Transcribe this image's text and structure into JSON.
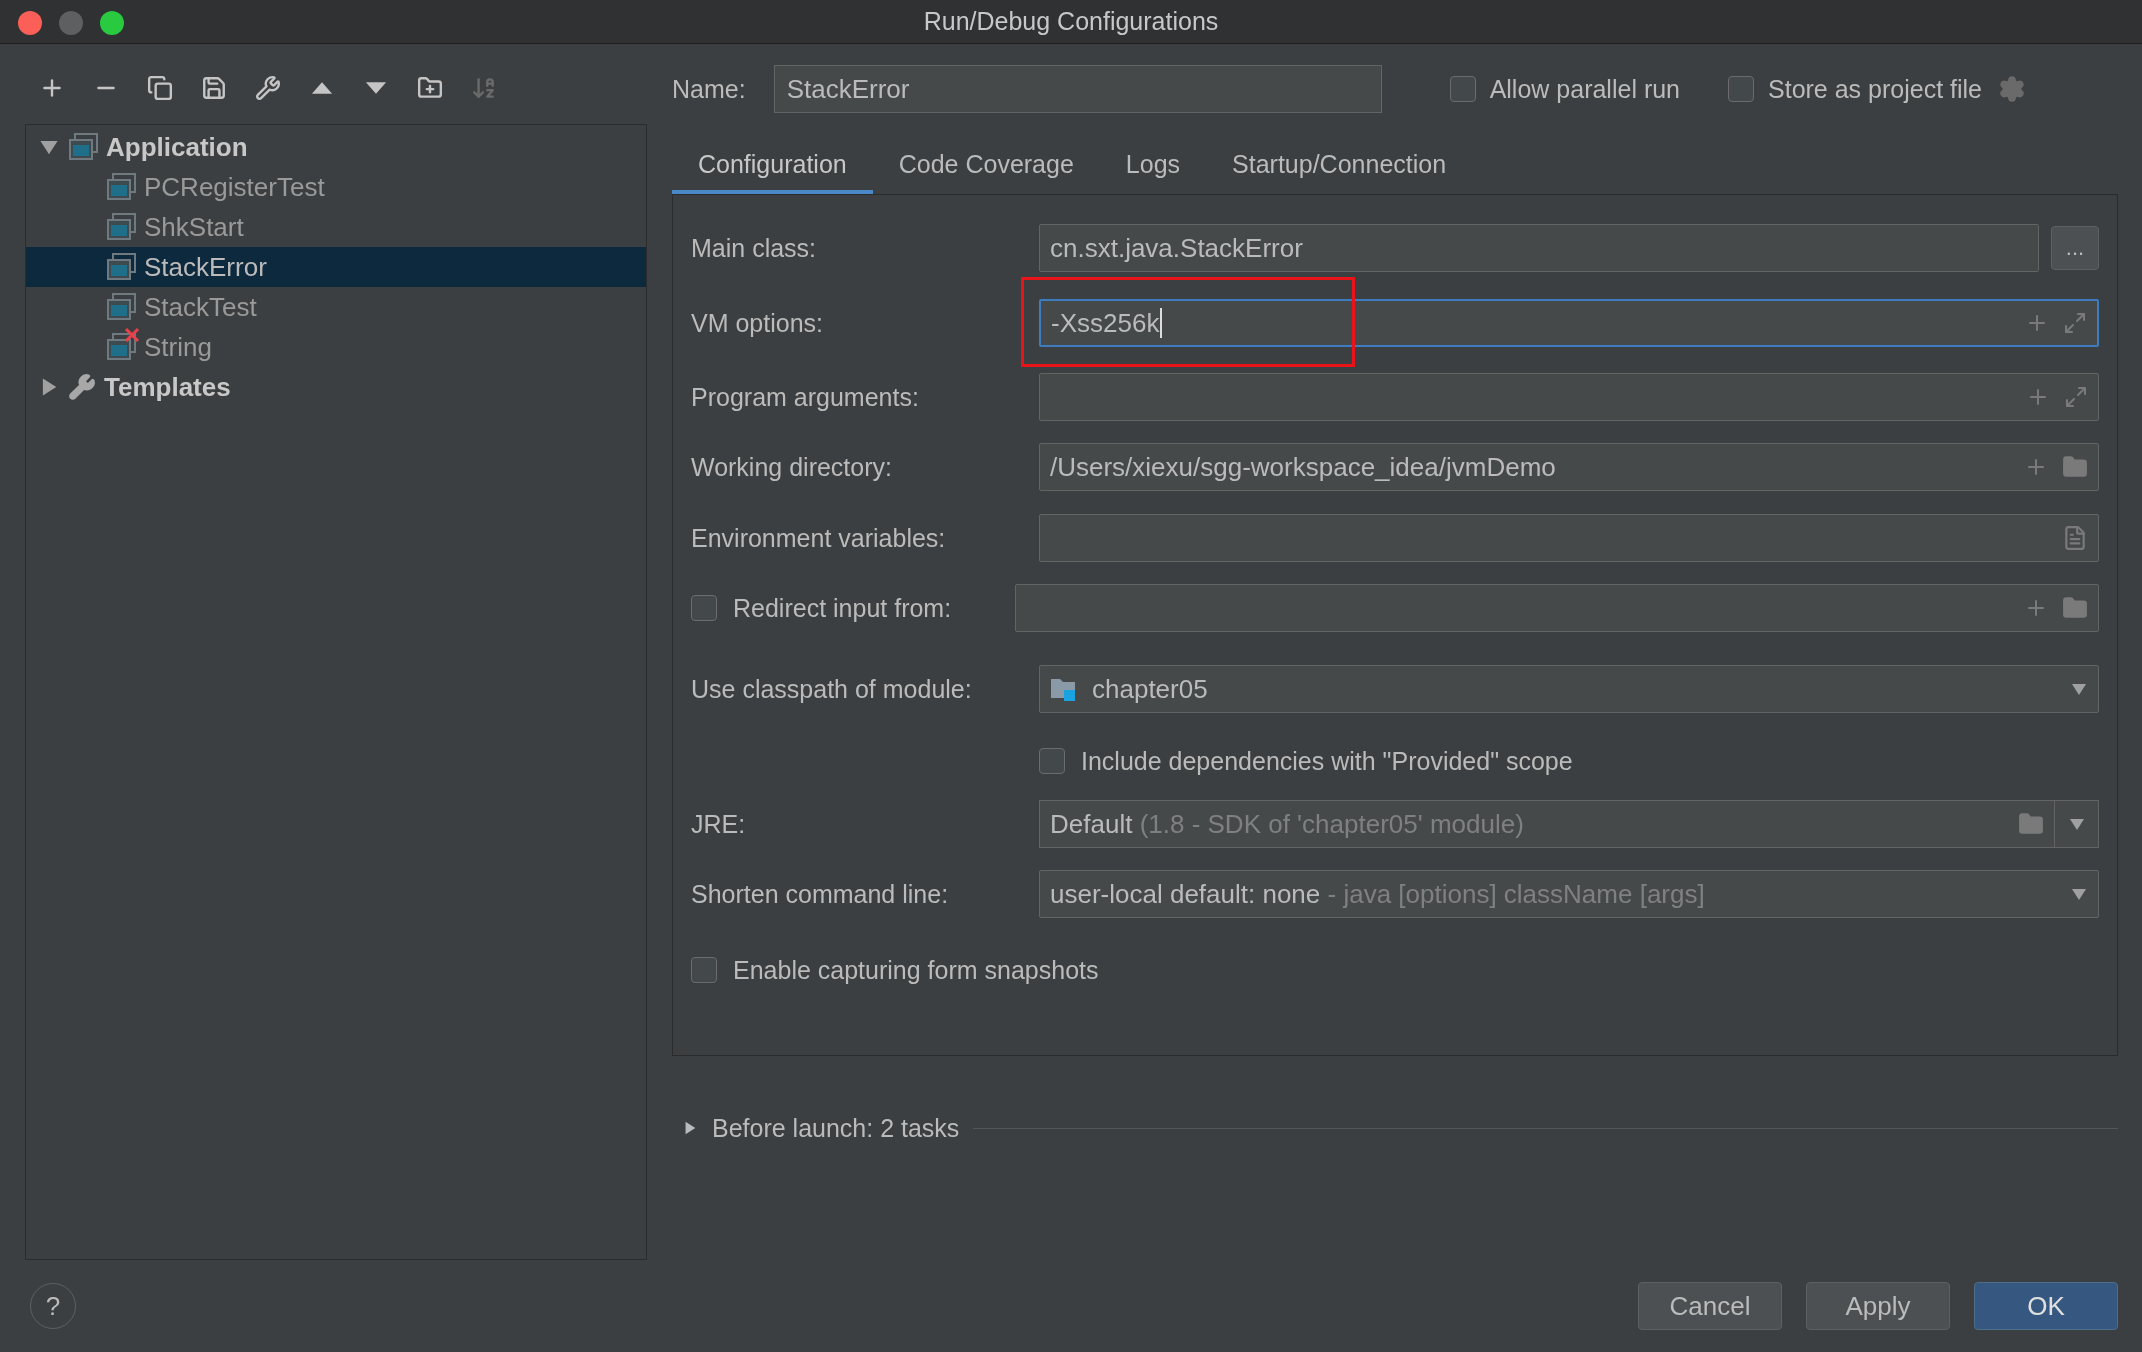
{
  "window": {
    "title": "Run/Debug Configurations"
  },
  "tree": [
    {
      "label": "Application",
      "kind": "application",
      "expanded": true,
      "children": [
        {
          "label": "PCRegisterTest",
          "selected": false,
          "error": false
        },
        {
          "label": "ShkStart",
          "selected": false,
          "error": false
        },
        {
          "label": "StackError",
          "selected": true,
          "error": false
        },
        {
          "label": "StackTest",
          "selected": false,
          "error": false
        },
        {
          "label": "String",
          "selected": false,
          "error": true
        }
      ]
    },
    {
      "label": "Templates",
      "kind": "templates",
      "expanded": false
    }
  ],
  "name": {
    "label": "Name:",
    "value": "StackError"
  },
  "options": [
    {
      "label": "Allow parallel run",
      "checked": false
    },
    {
      "label": "Store as project file",
      "checked": false
    }
  ],
  "tabs": [
    {
      "label": "Configuration",
      "selected": true
    },
    {
      "label": "Code Coverage",
      "selected": false
    },
    {
      "label": "Logs",
      "selected": false
    },
    {
      "label": "Startup/Connection",
      "selected": false
    }
  ],
  "form": [
    {
      "kind": "browse",
      "label": "Main class:",
      "value": "cn.sxt.java.StackError",
      "button": "..."
    },
    {
      "kind": "expand",
      "label": "VM options:",
      "value": "-Xss256k",
      "focused": true,
      "marked": true
    },
    {
      "kind": "expand",
      "label": "Program arguments:",
      "focused": false,
      "marked": false
    },
    {
      "kind": "folder",
      "label": "Working directory:",
      "value": "/Users/xiexu/sgg-workspace_idea/jvmDemo",
      "focused": false,
      "marked": false
    },
    {
      "kind": "env",
      "label": "Environment variables:"
    },
    {
      "kind": "checkfield",
      "label": "Redirect input from:",
      "checked": false
    },
    {
      "kind": "module",
      "label": "Use classpath of module:",
      "value": "chapter05"
    },
    {
      "kind": "check",
      "label": "Include dependencies with \"Provided\" scope",
      "checked": false,
      "indented": true
    },
    {
      "kind": "jre",
      "label": "JRE:",
      "value": "Default",
      "hint": "(1.8 - SDK of 'chapter05' module)"
    },
    {
      "kind": "select",
      "label": "Shorten command line:",
      "value": "user-local default: none",
      "hint": "- java [options] className [args]"
    },
    {
      "kind": "check",
      "label": "Enable capturing form snapshots",
      "checked": false,
      "indented": false
    }
  ],
  "before_launch": {
    "label": "Before launch: 2 tasks",
    "expanded": false
  },
  "help": "?",
  "buttons": [
    {
      "label": "Cancel",
      "default": false
    },
    {
      "label": "Apply",
      "default": false
    },
    {
      "label": "OK",
      "default": true
    }
  ]
}
